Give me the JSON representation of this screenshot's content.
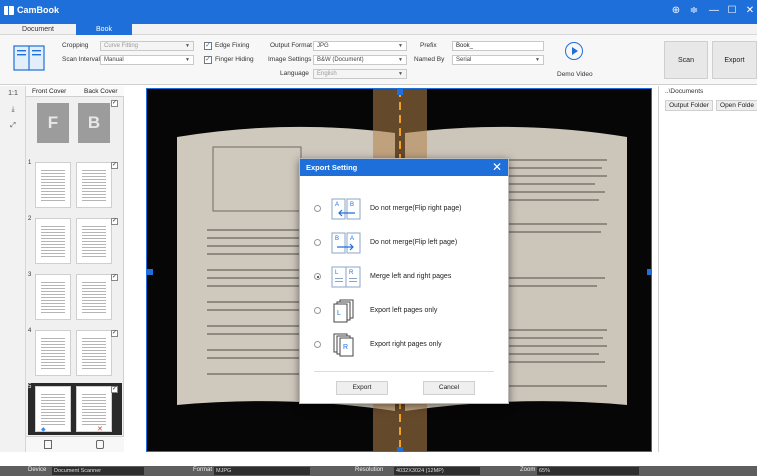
{
  "app": {
    "title": "CamBook"
  },
  "tabs": [
    {
      "label": "Document"
    },
    {
      "label": "Book"
    }
  ],
  "toolbar": {
    "cropping_label": "Cropping",
    "cropping_value": "Curve Fitting",
    "scan_interval_label": "Scan Interval",
    "scan_interval_value": "Manual",
    "edge_fixing_label": "Edge Fixing",
    "finger_hiding_label": "Finger Hiding",
    "output_format_label": "Output Format",
    "output_format_value": "JPG",
    "image_settings_label": "Image Settings",
    "image_settings_value": "B&W (Document)",
    "language_label": "Language",
    "language_value": "English",
    "prefix_label": "Prefix",
    "prefix_value": "Book_",
    "named_by_label": "Named By",
    "named_by_value": "Serial",
    "demo_video_label": "Demo Video",
    "scan_label": "Scan",
    "export_label": "Export"
  },
  "minibar": {
    "ratio_label": "1:1"
  },
  "thumbs": {
    "front_cover_label": "Front Cover",
    "back_cover_label": "Back Cover",
    "front_letter": "F",
    "back_letter": "B",
    "rows": [
      {
        "num": "1"
      },
      {
        "num": "2"
      },
      {
        "num": "3"
      },
      {
        "num": "4"
      },
      {
        "num": "5"
      }
    ]
  },
  "right_panel": {
    "path": "..\\Documents",
    "output_folder_label": "Output Folder",
    "open_folder_label": "Open Folde"
  },
  "status": {
    "device_label": "Device",
    "device_value": "Document Scanner",
    "format_label": "Format",
    "format_value": "MJPG",
    "resolution_label": "Resolution",
    "resolution_value": "4032X3024 (12MP)",
    "zoom_label": "Zoom",
    "zoom_value": "65%"
  },
  "dialog": {
    "title": "Export Setting",
    "options": [
      {
        "label": "Do not merge(Flip right page)",
        "selected": false
      },
      {
        "label": "Do not merge(Flip left page)",
        "selected": false
      },
      {
        "label": "Merge left and right pages",
        "selected": true
      },
      {
        "label": "Export left pages only",
        "selected": false
      },
      {
        "label": "Export right pages only",
        "selected": false
      }
    ],
    "export_label": "Export",
    "cancel_label": "Cancel"
  },
  "colors": {
    "accent": "#1e6fd9",
    "statusbar": "#5e5e5e",
    "viewer_bg": "#050505"
  }
}
